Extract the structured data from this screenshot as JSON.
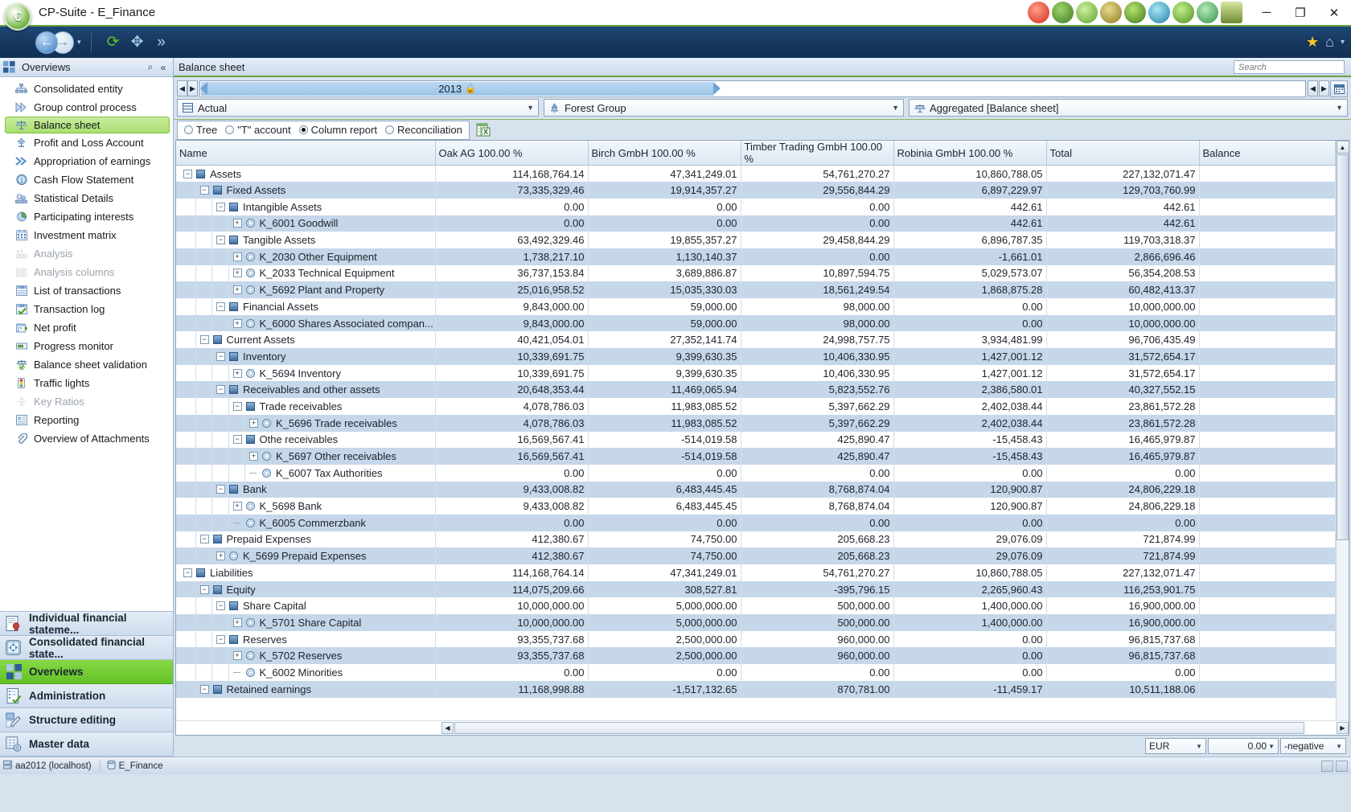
{
  "window": {
    "title": "CP-Suite - E_Finance",
    "minimize_label": "─",
    "maximize_label": "❐",
    "close_label": "✕",
    "title_icons": [
      "tomato-icon",
      "cactus-icon",
      "leaf-icon",
      "bean-icon",
      "apple-icon",
      "ring-icon",
      "molecule-icon",
      "sphere-icon",
      "bag-icon"
    ]
  },
  "toolbar": {
    "back_label": "←",
    "forward_label": "→",
    "dropdown_label": "▾",
    "refresh_label": "⟳",
    "move_label": "✥",
    "next_label": "»",
    "favorites_label": "★",
    "home_label": "⌂",
    "more_label": "▾"
  },
  "sidebar": {
    "header_title": "Overviews",
    "search_label": "⌕",
    "collapse_label": "«",
    "header_icon": "squares-icon",
    "items": [
      {
        "label": "Consolidated entity",
        "icon": "org-chart-icon",
        "selected": false,
        "disabled": false
      },
      {
        "label": "Group control process",
        "icon": "double-chevron-icon",
        "selected": false,
        "disabled": false
      },
      {
        "label": "Balance sheet",
        "icon": "scales-icon",
        "selected": true,
        "disabled": false
      },
      {
        "label": "Profit and Loss Account",
        "icon": "pl-icon",
        "selected": false,
        "disabled": false
      },
      {
        "label": "Appropriation of earnings",
        "icon": "double-arrow-icon",
        "selected": false,
        "disabled": false
      },
      {
        "label": "Cash Flow Statement",
        "icon": "coin-icon",
        "selected": false,
        "disabled": false
      },
      {
        "label": "Statistical Details",
        "icon": "stats-icon",
        "selected": false,
        "disabled": false
      },
      {
        "label": "Participating interests",
        "icon": "pie-icon",
        "selected": false,
        "disabled": false
      },
      {
        "label": "Investment matrix",
        "icon": "matrix-icon",
        "selected": false,
        "disabled": false
      },
      {
        "label": "Analysis",
        "icon": "analysis-icon",
        "selected": false,
        "disabled": true
      },
      {
        "label": "Analysis columns",
        "icon": "analysis-columns-icon",
        "selected": false,
        "disabled": true
      },
      {
        "label": "List of transactions",
        "icon": "list-123-icon",
        "selected": false,
        "disabled": false
      },
      {
        "label": "Transaction log",
        "icon": "log-123-icon",
        "selected": false,
        "disabled": false
      },
      {
        "label": "Net profit",
        "icon": "calendar-plus-icon",
        "selected": false,
        "disabled": false
      },
      {
        "label": "Progress monitor",
        "icon": "progress-icon",
        "selected": false,
        "disabled": false
      },
      {
        "label": "Balance sheet validation",
        "icon": "validate-icon",
        "selected": false,
        "disabled": false
      },
      {
        "label": "Traffic lights",
        "icon": "traffic-light-icon",
        "selected": false,
        "disabled": false
      },
      {
        "label": "Key Ratios",
        "icon": "ratio-icon",
        "selected": false,
        "disabled": true
      },
      {
        "label": "Reporting",
        "icon": "report-icon",
        "selected": false,
        "disabled": false
      },
      {
        "label": "Overview of Attachments",
        "icon": "attachment-icon",
        "selected": false,
        "disabled": false
      }
    ],
    "groups": [
      {
        "label": "Individual financial stateme...",
        "icon": "seal-document-icon",
        "selected": false
      },
      {
        "label": "Consolidated financial state...",
        "icon": "consolidate-icon",
        "selected": false
      },
      {
        "label": "Overviews",
        "icon": "squares-icon",
        "selected": true
      },
      {
        "label": "Administration",
        "icon": "admin-check-icon",
        "selected": false
      },
      {
        "label": "Structure editing",
        "icon": "structure-edit-icon",
        "selected": false
      },
      {
        "label": "Master data",
        "icon": "master-data-icon",
        "selected": false
      }
    ]
  },
  "document": {
    "tab_title": "Balance sheet",
    "search_placeholder": "Search",
    "search_value": ""
  },
  "period": {
    "prev_label": "◀",
    "next_label": "▶",
    "year": "2013",
    "lock_icon": "open-padlock-icon",
    "step_prev_label": "◀",
    "step_next_label": "▶",
    "calendar_label": "🗓"
  },
  "filters": {
    "data_type": {
      "value": "Actual",
      "icon": "ledger-icon"
    },
    "entity": {
      "value": "Forest Group",
      "icon": "tree-group-icon"
    },
    "view": {
      "value": "Aggregated [Balance sheet]",
      "icon": "scales-icon"
    }
  },
  "view_modes": {
    "options": [
      {
        "label": "Tree",
        "selected": false
      },
      {
        "label": "\"T\" account",
        "selected": false
      },
      {
        "label": "Column report",
        "selected": true
      },
      {
        "label": "Reconciliation",
        "selected": false
      }
    ],
    "export_icon": "excel-export-icon"
  },
  "grid": {
    "columns": [
      "Name",
      "Oak AG 100.00 %",
      "Birch GmbH 100.00 %",
      "Timber Trading GmbH 100.00 %",
      "Robinia GmbH 100.00 %",
      "Total",
      "Balance"
    ],
    "rows": [
      {
        "indent": 0,
        "expander": "minus",
        "node": "group",
        "key": "",
        "label": "Assets",
        "values": [
          "114,168,764.14",
          "47,341,249.01",
          "54,761,270.27",
          "10,860,788.05",
          "227,132,071.47",
          ""
        ]
      },
      {
        "indent": 1,
        "expander": "minus",
        "node": "group",
        "key": "",
        "label": "Fixed Assets",
        "values": [
          "73,335,329.46",
          "19,914,357.27",
          "29,556,844.29",
          "6,897,229.97",
          "129,703,760.99",
          ""
        ]
      },
      {
        "indent": 2,
        "expander": "minus",
        "node": "group",
        "key": "",
        "label": "Intangible Assets",
        "values": [
          "0.00",
          "0.00",
          "0.00",
          "442.61",
          "442.61",
          ""
        ]
      },
      {
        "indent": 3,
        "expander": "plus",
        "node": "account",
        "key": "K_6001",
        "label": "Goodwill",
        "values": [
          "0.00",
          "0.00",
          "0.00",
          "442.61",
          "442.61",
          ""
        ]
      },
      {
        "indent": 2,
        "expander": "minus",
        "node": "group",
        "key": "",
        "label": "Tangible Assets",
        "values": [
          "63,492,329.46",
          "19,855,357.27",
          "29,458,844.29",
          "6,896,787.35",
          "119,703,318.37",
          ""
        ]
      },
      {
        "indent": 3,
        "expander": "plus",
        "node": "account",
        "key": "K_2030",
        "label": "Other Equipment",
        "values": [
          "1,738,217.10",
          "1,130,140.37",
          "0.00",
          "-1,661.01",
          "2,866,696.46",
          ""
        ]
      },
      {
        "indent": 3,
        "expander": "plus",
        "node": "account",
        "key": "K_2033",
        "label": "Technical Equipment",
        "values": [
          "36,737,153.84",
          "3,689,886.87",
          "10,897,594.75",
          "5,029,573.07",
          "56,354,208.53",
          ""
        ]
      },
      {
        "indent": 3,
        "expander": "plus",
        "node": "account",
        "key": "K_5692",
        "label": "Plant and Property",
        "values": [
          "25,016,958.52",
          "15,035,330.03",
          "18,561,249.54",
          "1,868,875.28",
          "60,482,413.37",
          ""
        ]
      },
      {
        "indent": 2,
        "expander": "minus",
        "node": "group",
        "key": "",
        "label": "Financial Assets",
        "values": [
          "9,843,000.00",
          "59,000.00",
          "98,000.00",
          "0.00",
          "10,000,000.00",
          ""
        ]
      },
      {
        "indent": 3,
        "expander": "plus",
        "node": "account",
        "key": "K_6000",
        "label": "Shares Associated compan...",
        "values": [
          "9,843,000.00",
          "59,000.00",
          "98,000.00",
          "0.00",
          "10,000,000.00",
          ""
        ]
      },
      {
        "indent": 1,
        "expander": "minus",
        "node": "group",
        "key": "",
        "label": "Current Assets",
        "values": [
          "40,421,054.01",
          "27,352,141.74",
          "24,998,757.75",
          "3,934,481.99",
          "96,706,435.49",
          ""
        ]
      },
      {
        "indent": 2,
        "expander": "minus",
        "node": "group",
        "key": "",
        "label": "Inventory",
        "values": [
          "10,339,691.75",
          "9,399,630.35",
          "10,406,330.95",
          "1,427,001.12",
          "31,572,654.17",
          ""
        ]
      },
      {
        "indent": 3,
        "expander": "plus",
        "node": "account",
        "key": "K_5694",
        "label": "Inventory",
        "values": [
          "10,339,691.75",
          "9,399,630.35",
          "10,406,330.95",
          "1,427,001.12",
          "31,572,654.17",
          ""
        ]
      },
      {
        "indent": 2,
        "expander": "minus",
        "node": "group",
        "key": "",
        "label": "Receivables and other assets",
        "values": [
          "20,648,353.44",
          "11,469,065.94",
          "5,823,552.76",
          "2,386,580.01",
          "40,327,552.15",
          ""
        ]
      },
      {
        "indent": 3,
        "expander": "minus",
        "node": "group",
        "key": "",
        "label": "Trade receivables",
        "values": [
          "4,078,786.03",
          "11,983,085.52",
          "5,397,662.29",
          "2,402,038.44",
          "23,861,572.28",
          ""
        ]
      },
      {
        "indent": 4,
        "expander": "plus",
        "node": "account",
        "key": "K_5696",
        "label": "Trade receivables",
        "values": [
          "4,078,786.03",
          "11,983,085.52",
          "5,397,662.29",
          "2,402,038.44",
          "23,861,572.28",
          ""
        ]
      },
      {
        "indent": 3,
        "expander": "minus",
        "node": "group",
        "key": "",
        "label": "Othe receivables",
        "values": [
          "16,569,567.41",
          "-514,019.58",
          "425,890.47",
          "-15,458.43",
          "16,465,979.87",
          ""
        ]
      },
      {
        "indent": 4,
        "expander": "plus",
        "node": "account",
        "key": "K_5697",
        "label": "Other receivables",
        "values": [
          "16,569,567.41",
          "-514,019.58",
          "425,890.47",
          "-15,458.43",
          "16,465,979.87",
          ""
        ]
      },
      {
        "indent": 4,
        "expander": "leaf",
        "node": "account",
        "key": "K_6007",
        "label": "Tax Authorities",
        "values": [
          "0.00",
          "0.00",
          "0.00",
          "0.00",
          "0.00",
          ""
        ]
      },
      {
        "indent": 2,
        "expander": "minus",
        "node": "group",
        "key": "",
        "label": "Bank",
        "values": [
          "9,433,008.82",
          "6,483,445.45",
          "8,768,874.04",
          "120,900.87",
          "24,806,229.18",
          ""
        ]
      },
      {
        "indent": 3,
        "expander": "plus",
        "node": "account",
        "key": "K_5698",
        "label": "Bank",
        "values": [
          "9,433,008.82",
          "6,483,445.45",
          "8,768,874.04",
          "120,900.87",
          "24,806,229.18",
          ""
        ]
      },
      {
        "indent": 3,
        "expander": "leaf",
        "node": "account",
        "key": "K_6005",
        "label": "Commerzbank",
        "values": [
          "0.00",
          "0.00",
          "0.00",
          "0.00",
          "0.00",
          ""
        ]
      },
      {
        "indent": 1,
        "expander": "minus",
        "node": "group",
        "key": "",
        "label": "Prepaid Expenses",
        "values": [
          "412,380.67",
          "74,750.00",
          "205,668.23",
          "29,076.09",
          "721,874.99",
          ""
        ]
      },
      {
        "indent": 2,
        "expander": "plus",
        "node": "account",
        "key": "K_5699",
        "label": "Prepaid Expenses",
        "values": [
          "412,380.67",
          "74,750.00",
          "205,668.23",
          "29,076.09",
          "721,874.99",
          ""
        ]
      },
      {
        "indent": 0,
        "expander": "minus",
        "node": "group",
        "key": "",
        "label": "Liabilities",
        "values": [
          "114,168,764.14",
          "47,341,249.01",
          "54,761,270.27",
          "10,860,788.05",
          "227,132,071.47",
          ""
        ]
      },
      {
        "indent": 1,
        "expander": "minus",
        "node": "group",
        "key": "",
        "label": "Equity",
        "values": [
          "114,075,209.66",
          "308,527.81",
          "-395,796.15",
          "2,265,960.43",
          "116,253,901.75",
          ""
        ]
      },
      {
        "indent": 2,
        "expander": "minus",
        "node": "group",
        "key": "",
        "label": "Share Capital",
        "values": [
          "10,000,000.00",
          "5,000,000.00",
          "500,000.00",
          "1,400,000.00",
          "16,900,000.00",
          ""
        ]
      },
      {
        "indent": 3,
        "expander": "plus",
        "node": "account",
        "key": "K_5701",
        "label": "Share Capital",
        "values": [
          "10,000,000.00",
          "5,000,000.00",
          "500,000.00",
          "1,400,000.00",
          "16,900,000.00",
          ""
        ]
      },
      {
        "indent": 2,
        "expander": "minus",
        "node": "group",
        "key": "",
        "label": "Reserves",
        "values": [
          "93,355,737.68",
          "2,500,000.00",
          "960,000.00",
          "0.00",
          "96,815,737.68",
          ""
        ]
      },
      {
        "indent": 3,
        "expander": "plus",
        "node": "account",
        "key": "K_5702",
        "label": "Reserves",
        "values": [
          "93,355,737.68",
          "2,500,000.00",
          "960,000.00",
          "0.00",
          "96,815,737.68",
          ""
        ]
      },
      {
        "indent": 3,
        "expander": "leaf",
        "node": "account",
        "key": "K_6002",
        "label": "Minorities",
        "values": [
          "0.00",
          "0.00",
          "0.00",
          "0.00",
          "0.00",
          ""
        ]
      },
      {
        "indent": 1,
        "expander": "minus",
        "node": "group",
        "key": "",
        "label": "Retained earnings",
        "values": [
          "11,168,998.88",
          "-1,517,132.65",
          "870,781.00",
          "-11,459.17",
          "10,511,188.06",
          ""
        ]
      }
    ]
  },
  "footer": {
    "currency": "EUR",
    "scaling": "0.00",
    "sign_mode": "-negative"
  },
  "statusbar": {
    "server": "aa2012 (localhost)",
    "database": "E_Finance",
    "server_icon": "server-icon",
    "db-icon": "database-icon"
  }
}
